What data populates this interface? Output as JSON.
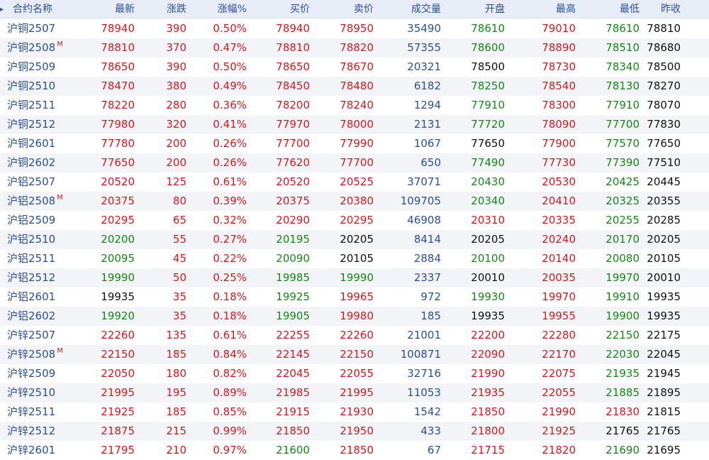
{
  "colors": {
    "up": "#e0161b",
    "down": "#138a13",
    "volume": "#2a4f9e",
    "text": "#111111",
    "header_bg": "#e8ecf6"
  },
  "header": {
    "sort_marker": "▸",
    "cols": [
      "合约名称",
      "最新",
      "涨跌",
      "涨幅%",
      "买价",
      "卖价",
      "成交量",
      "开盘",
      "最高",
      "最低",
      "昨收"
    ]
  },
  "rows": [
    {
      "name": "沪铜2507",
      "m": "",
      "last": "78940",
      "chg": "390",
      "pct": "0.50%",
      "bid": "78940",
      "ask": "78950",
      "vol": "35490",
      "open": "78610",
      "high": "79010",
      "low": "78610",
      "prev": "78810"
    },
    {
      "name": "沪铜2508",
      "m": "M",
      "last": "78810",
      "chg": "370",
      "pct": "0.47%",
      "bid": "78810",
      "ask": "78820",
      "vol": "57355",
      "open": "78600",
      "high": "78890",
      "low": "78510",
      "prev": "78680"
    },
    {
      "name": "沪铜2509",
      "m": "",
      "last": "78650",
      "chg": "390",
      "pct": "0.50%",
      "bid": "78650",
      "ask": "78670",
      "vol": "20321",
      "open": "78500",
      "high": "78730",
      "low": "78340",
      "prev": "78500"
    },
    {
      "name": "沪铜2510",
      "m": "",
      "last": "78470",
      "chg": "380",
      "pct": "0.49%",
      "bid": "78450",
      "ask": "78480",
      "vol": "6182",
      "open": "78250",
      "high": "78540",
      "low": "78130",
      "prev": "78270"
    },
    {
      "name": "沪铜2511",
      "m": "",
      "last": "78220",
      "chg": "280",
      "pct": "0.36%",
      "bid": "78200",
      "ask": "78240",
      "vol": "1294",
      "open": "77910",
      "high": "78300",
      "low": "77910",
      "prev": "78070"
    },
    {
      "name": "沪铜2512",
      "m": "",
      "last": "77980",
      "chg": "320",
      "pct": "0.41%",
      "bid": "77970",
      "ask": "78000",
      "vol": "2131",
      "open": "77720",
      "high": "78090",
      "low": "77700",
      "prev": "77830"
    },
    {
      "name": "沪铜2601",
      "m": "",
      "last": "77780",
      "chg": "200",
      "pct": "0.26%",
      "bid": "77700",
      "ask": "77990",
      "vol": "1067",
      "open": "77650",
      "high": "77900",
      "low": "77570",
      "prev": "77650"
    },
    {
      "name": "沪铜2602",
      "m": "",
      "last": "77650",
      "chg": "200",
      "pct": "0.26%",
      "bid": "77620",
      "ask": "77700",
      "vol": "650",
      "open": "77490",
      "high": "77730",
      "low": "77390",
      "prev": "77510"
    },
    {
      "name": "沪铝2507",
      "m": "",
      "last": "20520",
      "chg": "125",
      "pct": "0.61%",
      "bid": "20520",
      "ask": "20525",
      "vol": "37071",
      "open": "20430",
      "high": "20530",
      "low": "20425",
      "prev": "20445"
    },
    {
      "name": "沪铝2508",
      "m": "M",
      "last": "20375",
      "chg": "80",
      "pct": "0.39%",
      "bid": "20375",
      "ask": "20380",
      "vol": "109705",
      "open": "20340",
      "high": "20410",
      "low": "20325",
      "prev": "20355"
    },
    {
      "name": "沪铝2509",
      "m": "",
      "last": "20295",
      "chg": "65",
      "pct": "0.32%",
      "bid": "20290",
      "ask": "20295",
      "vol": "46908",
      "open": "20310",
      "high": "20335",
      "low": "20255",
      "prev": "20285"
    },
    {
      "name": "沪铝2510",
      "m": "",
      "last": "20200",
      "chg": "55",
      "pct": "0.27%",
      "bid": "20195",
      "ask": "20205",
      "vol": "8414",
      "open": "20205",
      "high": "20240",
      "low": "20170",
      "prev": "20205"
    },
    {
      "name": "沪铝2511",
      "m": "",
      "last": "20095",
      "chg": "45",
      "pct": "0.22%",
      "bid": "20090",
      "ask": "20105",
      "vol": "2884",
      "open": "20100",
      "high": "20140",
      "low": "20080",
      "prev": "20105"
    },
    {
      "name": "沪铝2512",
      "m": "",
      "last": "19990",
      "chg": "50",
      "pct": "0.25%",
      "bid": "19985",
      "ask": "19990",
      "vol": "2337",
      "open": "20010",
      "high": "20035",
      "low": "19970",
      "prev": "20010"
    },
    {
      "name": "沪铝2601",
      "m": "",
      "last": "19935",
      "chg": "35",
      "pct": "0.18%",
      "bid": "19925",
      "ask": "19965",
      "vol": "972",
      "open": "19930",
      "high": "19970",
      "low": "19910",
      "prev": "19935"
    },
    {
      "name": "沪铝2602",
      "m": "",
      "last": "19920",
      "chg": "35",
      "pct": "0.18%",
      "bid": "19905",
      "ask": "19980",
      "vol": "185",
      "open": "19935",
      "high": "19955",
      "low": "19900",
      "prev": "19935"
    },
    {
      "name": "沪锌2507",
      "m": "",
      "last": "22260",
      "chg": "135",
      "pct": "0.61%",
      "bid": "22255",
      "ask": "22260",
      "vol": "21001",
      "open": "22200",
      "high": "22280",
      "low": "22150",
      "prev": "22175"
    },
    {
      "name": "沪锌2508",
      "m": "M",
      "last": "22150",
      "chg": "185",
      "pct": "0.84%",
      "bid": "22145",
      "ask": "22150",
      "vol": "100871",
      "open": "22090",
      "high": "22170",
      "low": "22030",
      "prev": "22045"
    },
    {
      "name": "沪锌2509",
      "m": "",
      "last": "22050",
      "chg": "180",
      "pct": "0.82%",
      "bid": "22045",
      "ask": "22055",
      "vol": "32716",
      "open": "21990",
      "high": "22075",
      "low": "21935",
      "prev": "21945"
    },
    {
      "name": "沪锌2510",
      "m": "",
      "last": "21995",
      "chg": "195",
      "pct": "0.89%",
      "bid": "21985",
      "ask": "21995",
      "vol": "11053",
      "open": "21935",
      "high": "22055",
      "low": "21885",
      "prev": "21895"
    },
    {
      "name": "沪锌2511",
      "m": "",
      "last": "21925",
      "chg": "185",
      "pct": "0.85%",
      "bid": "21915",
      "ask": "21930",
      "vol": "1542",
      "open": "21850",
      "high": "21990",
      "low": "21830",
      "prev": "21815"
    },
    {
      "name": "沪锌2512",
      "m": "",
      "last": "21875",
      "chg": "215",
      "pct": "0.99%",
      "bid": "21850",
      "ask": "21950",
      "vol": "433",
      "open": "21800",
      "high": "21925",
      "low": "21765",
      "prev": "21765"
    },
    {
      "name": "沪锌2601",
      "m": "",
      "last": "21795",
      "chg": "210",
      "pct": "0.97%",
      "bid": "21600",
      "ask": "21850",
      "vol": "67",
      "open": "21715",
      "high": "21820",
      "low": "21690",
      "prev": "21695"
    }
  ]
}
